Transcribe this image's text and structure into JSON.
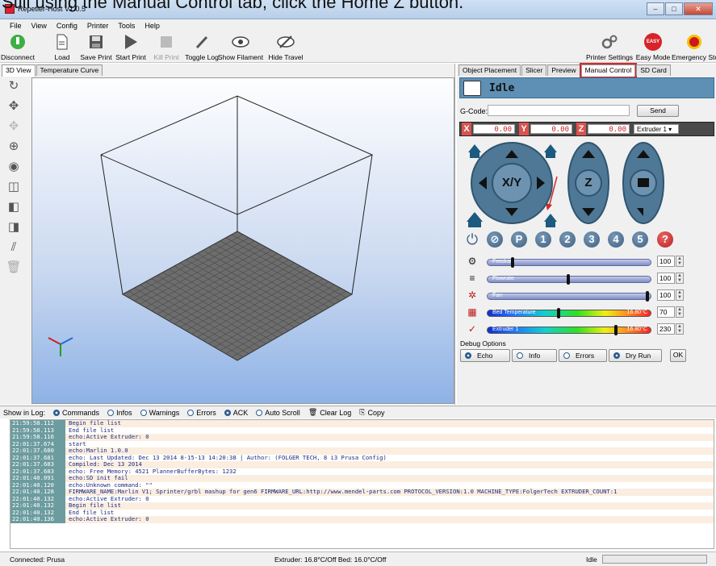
{
  "caption": "Still using the Manual Control tab, click the Home Z button.",
  "window": {
    "title": "Repetier-Host V1.0.5"
  },
  "menu": [
    "File",
    "View",
    "Config",
    "Printer",
    "Tools",
    "Help"
  ],
  "toolbar": {
    "disconnect": "Disconnect",
    "load": "Load",
    "save_print": "Save Print",
    "start_print": "Start Print",
    "kill_print": "Kill Print",
    "toggle_log": "Toggle Log",
    "show_filament": "Show Filament",
    "hide_travel": "Hide Travel",
    "printer_settings": "Printer Settings",
    "easy_mode": "Easy Mode",
    "easy_badge": "EASY",
    "emergency_stop": "Emergency Stop"
  },
  "left_tabs": [
    "3D View",
    "Temperature Curve"
  ],
  "right_tabs": [
    "Object Placement",
    "Slicer",
    "Preview",
    "Manual Control",
    "SD Card"
  ],
  "manual": {
    "status": "Idle",
    "gcode_label": "G-Code:",
    "gcode_value": "",
    "send": "Send",
    "coords": {
      "x_label": "X",
      "x": "0.00",
      "y_label": "Y",
      "y": "0.00",
      "z_label": "Z",
      "z": "0.00"
    },
    "extruder_select": "Extruder 1",
    "xy_label": "X/Y",
    "z_label": "Z",
    "numbers": [
      "P",
      "1",
      "2",
      "3",
      "4",
      "5"
    ],
    "feedrate": {
      "label": "Feedrate",
      "value": "100",
      "level": 0.15
    },
    "flowrate": {
      "label": "Flowrate",
      "value": "100",
      "level": 0.5
    },
    "fan": {
      "label": "Fan",
      "value": "100",
      "level": 1.0
    },
    "bed": {
      "label": "Bed Temperature",
      "readout": "16.80°C",
      "value": "70",
      "level": 0.44
    },
    "extruder": {
      "label": "Extruder 1",
      "readout": "16.80°C",
      "value": "230",
      "level": 0.8
    },
    "debug_title": "Debug Options",
    "debug": [
      "Echo",
      "Info",
      "Errors",
      "Dry Run"
    ],
    "ok": "OK"
  },
  "log": {
    "show_label": "Show in Log:",
    "options": [
      "Commands",
      "Infos",
      "Warnings",
      "Errors",
      "ACK",
      "Auto Scroll"
    ],
    "clear": "Clear Log",
    "copy": "Copy",
    "rows": [
      {
        "t": "21:59:58.112",
        "m": "Begin file list"
      },
      {
        "t": "21:59:58.113",
        "m": "End file list"
      },
      {
        "t": "21:59:58.116",
        "m": "echo:Active Extruder: 0"
      },
      {
        "t": "22:01:37.674",
        "m": "start"
      },
      {
        "t": "22:01:37.680",
        "m": "echo:Marlin 1.0.0"
      },
      {
        "t": "22:01:37.681",
        "m": "echo: Last Updated: Dec 13 2014  8-15-13 14:20:38 | Author: (FOLGER TECH, 8 i3 Prusa Config)"
      },
      {
        "t": "22:01:37.683",
        "m": "Compiled: Dec 13 2014"
      },
      {
        "t": "22:01:37.683",
        "m": "echo: Free Memory: 4521  PlannerBufferBytes: 1232"
      },
      {
        "t": "22:01:40.091",
        "m": "echo:SD init fail"
      },
      {
        "t": "22:01:40.120",
        "m": "echo:Unknown command: \"\""
      },
      {
        "t": "22:01:40.128",
        "m": "FIRMWARE_NAME:Marlin V1; Sprinter/grbl mashup for gen6 FIRMWARE_URL:http://www.mendel-parts.com PROTOCOL_VERSION:1.0 MACHINE_TYPE:FolgerTech EXTRUDER_COUNT:1"
      },
      {
        "t": "22:01:40.132",
        "m": "echo:Active Extruder: 0"
      },
      {
        "t": "22:01:40.132",
        "m": "Begin file list"
      },
      {
        "t": "22:01:40.132",
        "m": "End file list"
      },
      {
        "t": "22:01:40.136",
        "m": "echo:Active Extruder: 0"
      }
    ]
  },
  "status": {
    "connected": "Connected: Prusa",
    "temps": "Extruder: 16.8°C/Off Bed: 16.0°C/Off",
    "state": "Idle"
  },
  "colors": {
    "highlight": "#d02a2a",
    "accent": "#3d5f80"
  }
}
